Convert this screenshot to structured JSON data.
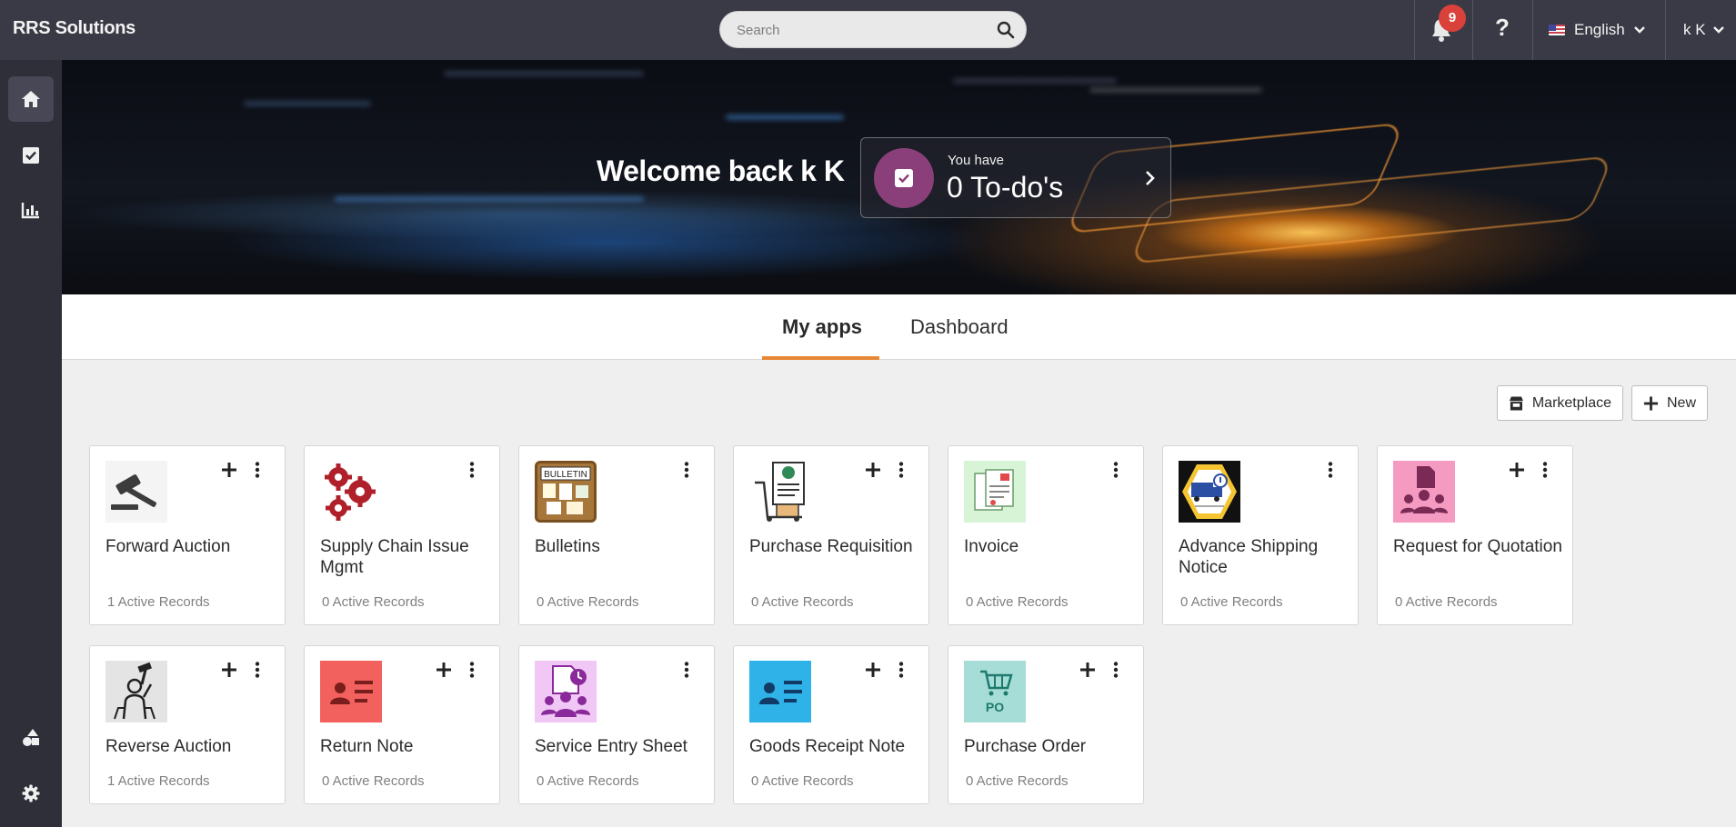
{
  "header": {
    "brand": "RRS Solutions",
    "search_placeholder": "Search",
    "notification_count": "9",
    "help_label": "?",
    "language": "English",
    "user": "k K"
  },
  "banner": {
    "welcome": "Welcome back k K",
    "todo_prefix": "You have",
    "todo_count": "0 To-do's"
  },
  "tabs": [
    {
      "label": "My apps",
      "active": true
    },
    {
      "label": "Dashboard",
      "active": false
    }
  ],
  "actions": {
    "marketplace": "Marketplace",
    "new": "New"
  },
  "apps": [
    {
      "title": "Forward Auction",
      "records": "1 Active Records",
      "has_add": true,
      "icon": "gavel-icon"
    },
    {
      "title": "Supply Chain Issue Mgmt",
      "records": "0 Active Records",
      "has_add": false,
      "icon": "gears-icon"
    },
    {
      "title": "Bulletins",
      "records": "0 Active Records",
      "has_add": false,
      "icon": "bulletin-board-icon",
      "icon_text": "BULLETIN"
    },
    {
      "title": "Purchase Requisition",
      "records": "0 Active Records",
      "has_add": true,
      "icon": "requisition-trolley-icon"
    },
    {
      "title": "Invoice",
      "records": "0 Active Records",
      "has_add": false,
      "icon": "invoice-documents-icon"
    },
    {
      "title": "Advance Shipping Notice",
      "records": "0 Active Records",
      "has_add": false,
      "icon": "shipping-truck-icon"
    },
    {
      "title": "Request for Quotation",
      "records": "0 Active Records",
      "has_add": true,
      "icon": "quotation-people-icon"
    },
    {
      "title": "Reverse Auction",
      "records": "1 Active Records",
      "has_add": true,
      "icon": "auctioneer-icon"
    },
    {
      "title": "Return Note",
      "records": "0 Active Records",
      "has_add": true,
      "icon": "return-note-icon"
    },
    {
      "title": "Service Entry Sheet",
      "records": "0 Active Records",
      "has_add": false,
      "icon": "service-entry-icon"
    },
    {
      "title": "Goods Receipt Note",
      "records": "0 Active Records",
      "has_add": true,
      "icon": "goods-receipt-icon"
    },
    {
      "title": "Purchase Order",
      "records": "0 Active Records",
      "has_add": true,
      "icon": "purchase-order-icon",
      "icon_text": "PO"
    }
  ],
  "colors": {
    "topbar": "#3a3a46",
    "sidebar": "#2f2f3a",
    "accent": "#e88733",
    "badge": "#d9413a",
    "todo_circle": "#8a3f7a"
  }
}
